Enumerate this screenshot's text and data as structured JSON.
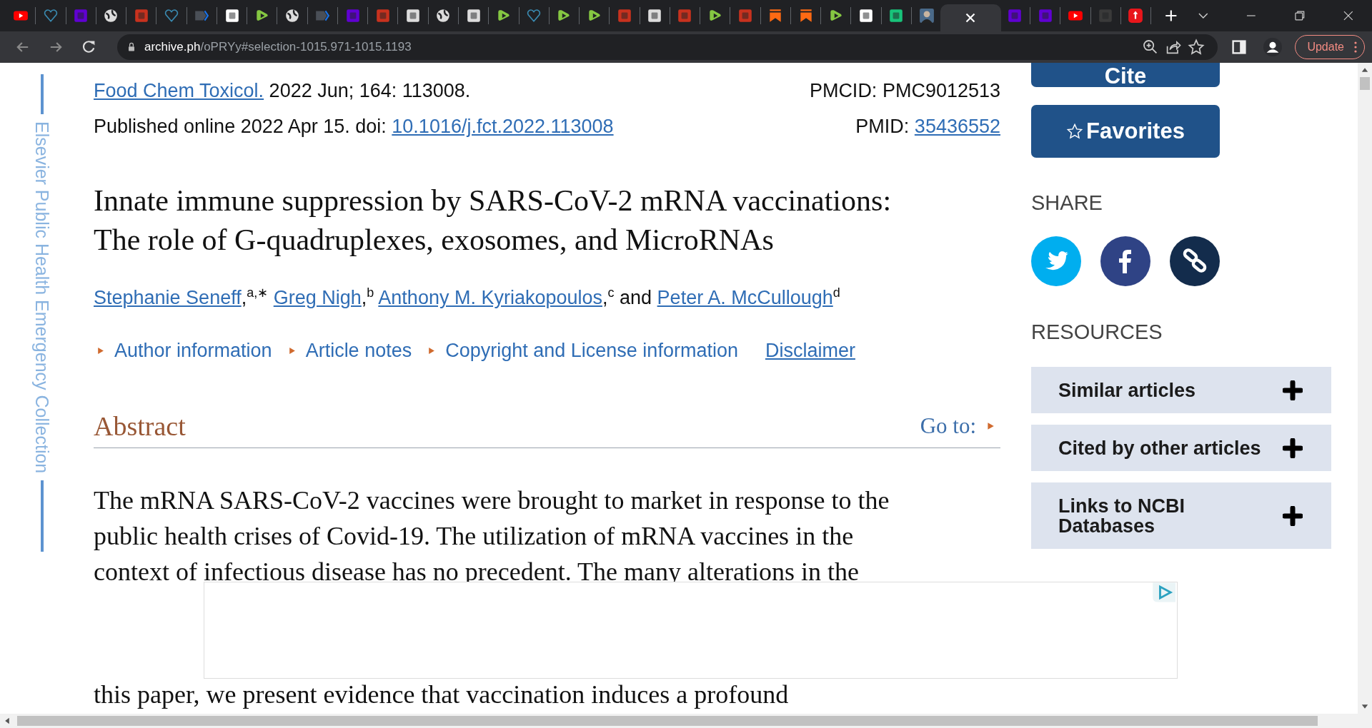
{
  "browser": {
    "tabs": [
      {
        "kind": "youtube",
        "selected": false
      },
      {
        "kind": "heart",
        "selected": false
      },
      {
        "kind": "yahoo",
        "selected": false
      },
      {
        "kind": "globe",
        "selected": false
      },
      {
        "kind": "bi",
        "selected": false
      },
      {
        "kind": "heart",
        "selected": false
      },
      {
        "kind": "arrow",
        "selected": false
      },
      {
        "kind": "grid",
        "selected": false
      },
      {
        "kind": "rumble",
        "selected": false
      },
      {
        "kind": "globe",
        "selected": false
      },
      {
        "kind": "arrow",
        "selected": false
      },
      {
        "kind": "yahoo",
        "selected": false
      },
      {
        "kind": "bi",
        "selected": false
      },
      {
        "kind": "dr",
        "selected": false
      },
      {
        "kind": "globe",
        "selected": false
      },
      {
        "kind": "dr",
        "selected": false
      },
      {
        "kind": "rumble",
        "selected": false
      },
      {
        "kind": "heart",
        "selected": false
      },
      {
        "kind": "rumble",
        "selected": false
      },
      {
        "kind": "rumble",
        "selected": false
      },
      {
        "kind": "bi",
        "selected": false
      },
      {
        "kind": "dr",
        "selected": false
      },
      {
        "kind": "bi",
        "selected": false
      },
      {
        "kind": "rumble",
        "selected": false
      },
      {
        "kind": "bi",
        "selected": false
      },
      {
        "kind": "bookmark",
        "selected": false
      },
      {
        "kind": "bookmark",
        "selected": false
      },
      {
        "kind": "rumble",
        "selected": false
      },
      {
        "kind": "hw",
        "selected": false
      },
      {
        "kind": "g",
        "selected": false
      },
      {
        "kind": "photo",
        "selected": false
      },
      {
        "selected": true
      },
      {
        "kind": "yahoo",
        "selected": false
      },
      {
        "kind": "yahoo",
        "selected": false
      },
      {
        "kind": "youtube",
        "selected": false
      },
      {
        "kind": "p",
        "selected": false
      },
      {
        "kind": "pin",
        "selected": false
      }
    ],
    "address_host": "archive.ph",
    "address_path": "/oPRYy#selection-1015.971-1015.1193",
    "update_button": "Update"
  },
  "rail_label": "Elsevier Public Health Emergency Collection",
  "citation": {
    "journal": "Food Chem Toxicol.",
    "issue": " 2022 Jun; 164: 113008.",
    "pmcid": "PMCID: PMC9012513",
    "published": "Published online 2022 Apr 15. doi: ",
    "doi": "10.1016/j.fct.2022.113008",
    "pmid_label": "PMID: ",
    "pmid": "35436552"
  },
  "title": "Innate immune suppression by SARS-CoV-2 mRNA vaccinations: The role of G-quadruplexes, exosomes, and MicroRNAs",
  "authors": [
    {
      "name": "Stephanie Seneff",
      "comma": ",",
      "sup": "a,∗"
    },
    {
      "name": "Greg Nigh",
      "comma": ",",
      "sup": "b"
    },
    {
      "name": "Anthony M. Kyriakopoulos",
      "comma": ",",
      "sup": "c",
      "joiner": "and"
    },
    {
      "name": "Peter A. McCullough",
      "sup": "d"
    }
  ],
  "info_links": [
    {
      "label": "Author information",
      "kind": "toggle"
    },
    {
      "label": "Article notes",
      "kind": "toggle"
    },
    {
      "label": "Copyright and License information",
      "kind": "toggle"
    },
    {
      "label": "Disclaimer",
      "kind": "link"
    }
  ],
  "abstract": {
    "heading": "Abstract",
    "goto": "Go to:",
    "lines": [
      "The mRNA SARS-CoV-2 vaccines were brought to market in response to the",
      "public health crises of Covid-19. The utilization of mRNA vaccines in the",
      "context of infectious disease has no precedent. The many alterations in the"
    ],
    "tail_line": "this paper, we present evidence that vaccination induces a profound"
  },
  "sidebar": {
    "cite_button": "Cite",
    "favorites_button": "Favorites",
    "share_heading": "SHARE",
    "share": [
      {
        "kind": "twitter"
      },
      {
        "kind": "facebook"
      },
      {
        "kind": "link"
      }
    ],
    "resources_heading": "RESOURCES",
    "resources": [
      {
        "label": "Similar articles",
        "expanded": false
      },
      {
        "label": "Cited by other articles",
        "expanded": false
      },
      {
        "label": "Links to NCBI Databases",
        "expanded": false
      }
    ]
  }
}
